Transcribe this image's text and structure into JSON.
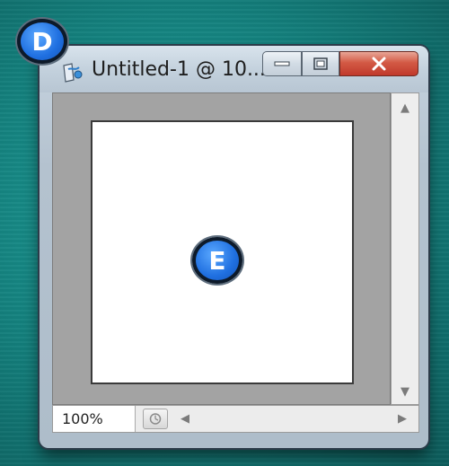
{
  "window": {
    "title": "Untitled-1 @ 10...",
    "minimize_icon": "minimize-icon",
    "maximize_icon": "restore-icon",
    "close_icon": "close-icon",
    "app_icon": "photoshop-document-icon"
  },
  "statusbar": {
    "zoom": "100%",
    "status_icon": "status-menu-icon"
  },
  "callouts": {
    "window_marker": "D",
    "canvas_marker": "E"
  },
  "colors": {
    "background": "#14807d",
    "close_button": "#c0392b",
    "badge": "#1f6fe0",
    "canvas": "#ffffff",
    "document_area": "#a3a3a3"
  }
}
